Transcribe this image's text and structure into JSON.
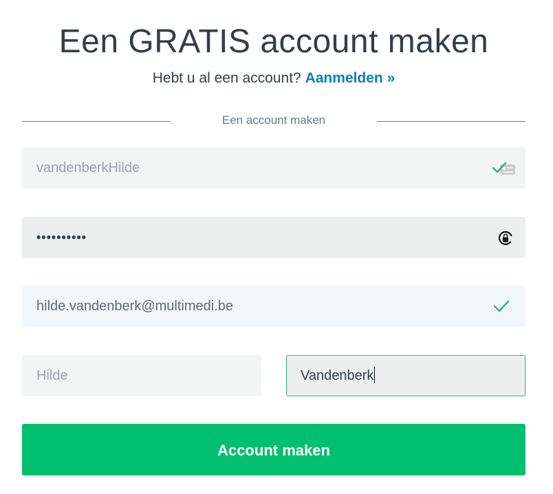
{
  "header": {
    "title": "Een GRATIS account maken",
    "subtitle_prefix": "Hebt u al een account?",
    "login_link": "Aanmelden »"
  },
  "divider": {
    "label": "Een account maken"
  },
  "form": {
    "username": {
      "value": "vandenberkHilde",
      "icons": [
        "check-icon",
        "autofill-icon"
      ]
    },
    "password": {
      "value": "••••••••••",
      "icon": "lock-icon"
    },
    "email": {
      "value": "hilde.vandenberk@multimedi.be",
      "icon": "check-icon"
    },
    "first_name": {
      "value": "Hilde"
    },
    "last_name": {
      "value": "Vandenberk"
    }
  },
  "submit": {
    "label": "Account maken"
  },
  "colors": {
    "accent_green": "#00bf6f",
    "link_blue": "#0a7eb6",
    "check_green": "#2fb36e",
    "text_dark": "#333e48"
  }
}
